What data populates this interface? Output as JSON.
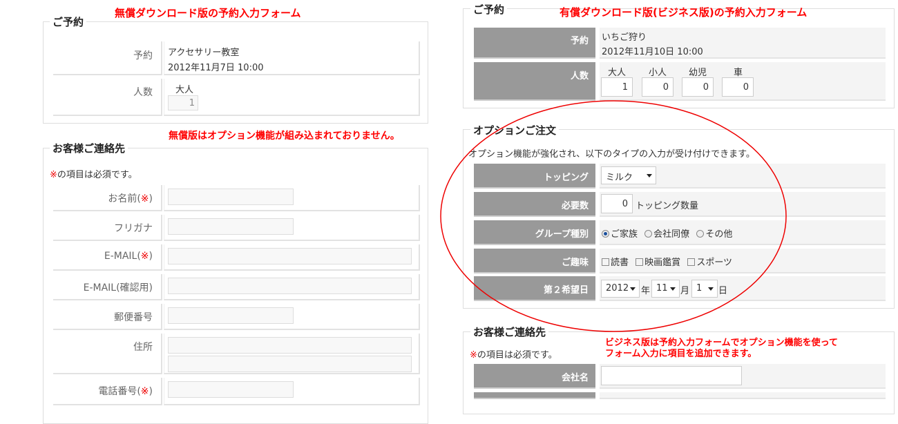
{
  "annotations": {
    "free_title": "無償ダウンロード版の予約入力フォーム",
    "free_note": "無償版はオプション機能が組み込まれておりません。",
    "paid_title": "有償ダウンロード版(ビジネス版)の予約入力フォーム",
    "paid_note_1": "ビジネス版は予約入力フォームでオプション機能を使って",
    "paid_note_2": "フォーム入力に項目を追加できます。"
  },
  "free": {
    "reservation": {
      "legend": "ご予約",
      "label_reservation": "予約",
      "event_name": "アクセサリー教室",
      "event_datetime": "2012年11月7日 10:00",
      "label_count": "人数",
      "adult_label": "大人",
      "adult_value": "1"
    },
    "contact": {
      "legend": "お客様ご連絡先",
      "required_mark": "※",
      "required_note": "の項目は必須です。",
      "fields": [
        {
          "pre": "お名前(",
          "mark": "※",
          "post": ")"
        },
        {
          "pre": "フリガナ",
          "mark": "",
          "post": ""
        },
        {
          "pre": "E-MAIL(",
          "mark": "※",
          "post": ")"
        },
        {
          "pre": "E-MAIL(確認用)",
          "mark": "",
          "post": ""
        },
        {
          "pre": "郵便番号",
          "mark": "",
          "post": ""
        },
        {
          "pre": "住所",
          "mark": "",
          "post": ""
        },
        {
          "pre": "電話番号(",
          "mark": "※",
          "post": ")"
        }
      ]
    }
  },
  "paid": {
    "reservation": {
      "legend": "ご予約",
      "label_reservation": "予約",
      "event_name": "いちご狩り",
      "event_datetime": "2012年11月10日 10:00",
      "label_count": "人数",
      "counts": [
        {
          "label": "大人",
          "value": "1"
        },
        {
          "label": "小人",
          "value": "0"
        },
        {
          "label": "幼児",
          "value": "0"
        },
        {
          "label": "車",
          "value": "0"
        }
      ]
    },
    "options": {
      "legend": "オプションご注文",
      "description": "オプション機能が強化され、以下のタイプの入力が受け付けできます。",
      "topping_label": "トッピング",
      "topping_value": "ミルク",
      "qty_label": "必要数",
      "qty_value": "0",
      "qty_suffix": "トッピング数量",
      "group_label": "グループ種別",
      "group_options": [
        "ご家族",
        "会社同僚",
        "その他"
      ],
      "hobby_label": "ご趣味",
      "hobby_options": [
        "読書",
        "映画鑑賞",
        "スポーツ"
      ],
      "date_label": "第２希望日",
      "year": "2012",
      "year_unit": "年",
      "month": "11",
      "month_unit": "月",
      "day": "1",
      "day_unit": "日"
    },
    "contact": {
      "legend": "お客様ご連絡先",
      "required_mark": "※",
      "required_note": "の項目は必須です。",
      "company_label": "会社名"
    }
  }
}
